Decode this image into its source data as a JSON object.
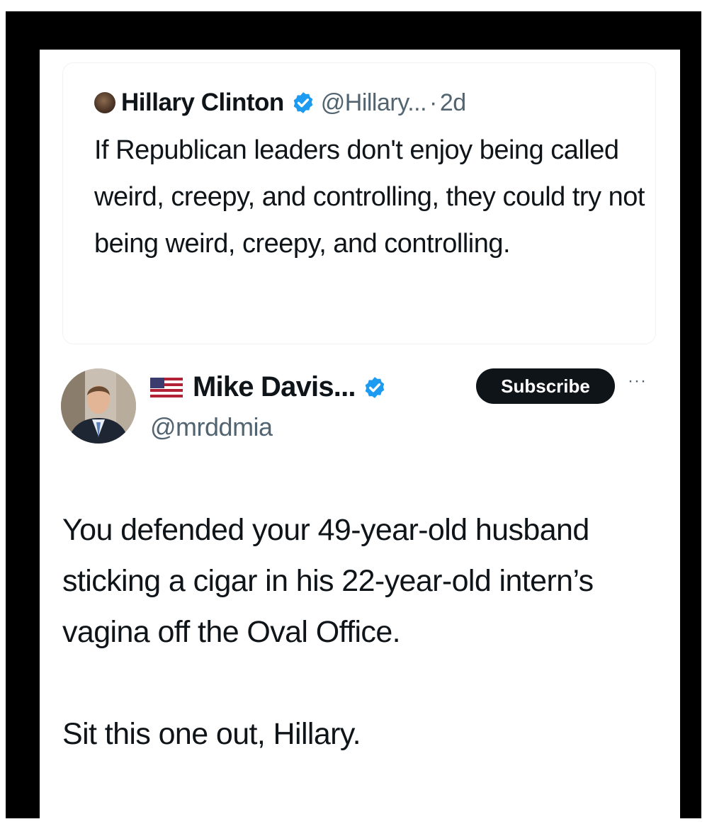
{
  "quoted_tweet": {
    "author_name": "Hillary Clinton",
    "handle": "@Hillary...",
    "separator": "·",
    "time": "2d",
    "text": "If Republican leaders don't enjoy being called weird, creepy, and controlling, they could try not being weird, creepy, and controlling."
  },
  "reply": {
    "author_name": "Mike Davis...",
    "handle": "@mrddmia",
    "subscribe_label": "Subscribe",
    "more_label": "···",
    "text_paragraph_1": "You defended your 49-year-old husband sticking a cigar in his 22-year-old intern’s vagina off the Oval Office.",
    "text_paragraph_2": "Sit this one out, Hillary."
  },
  "icons": {
    "verified": "verified-badge-icon",
    "flag": "us-flag-icon",
    "more": "more-options-icon"
  },
  "colors": {
    "verified_blue": "#1d9bf0",
    "frame": "#000000",
    "secondary_text": "#536471",
    "subscribe_bg": "#0f1419"
  }
}
